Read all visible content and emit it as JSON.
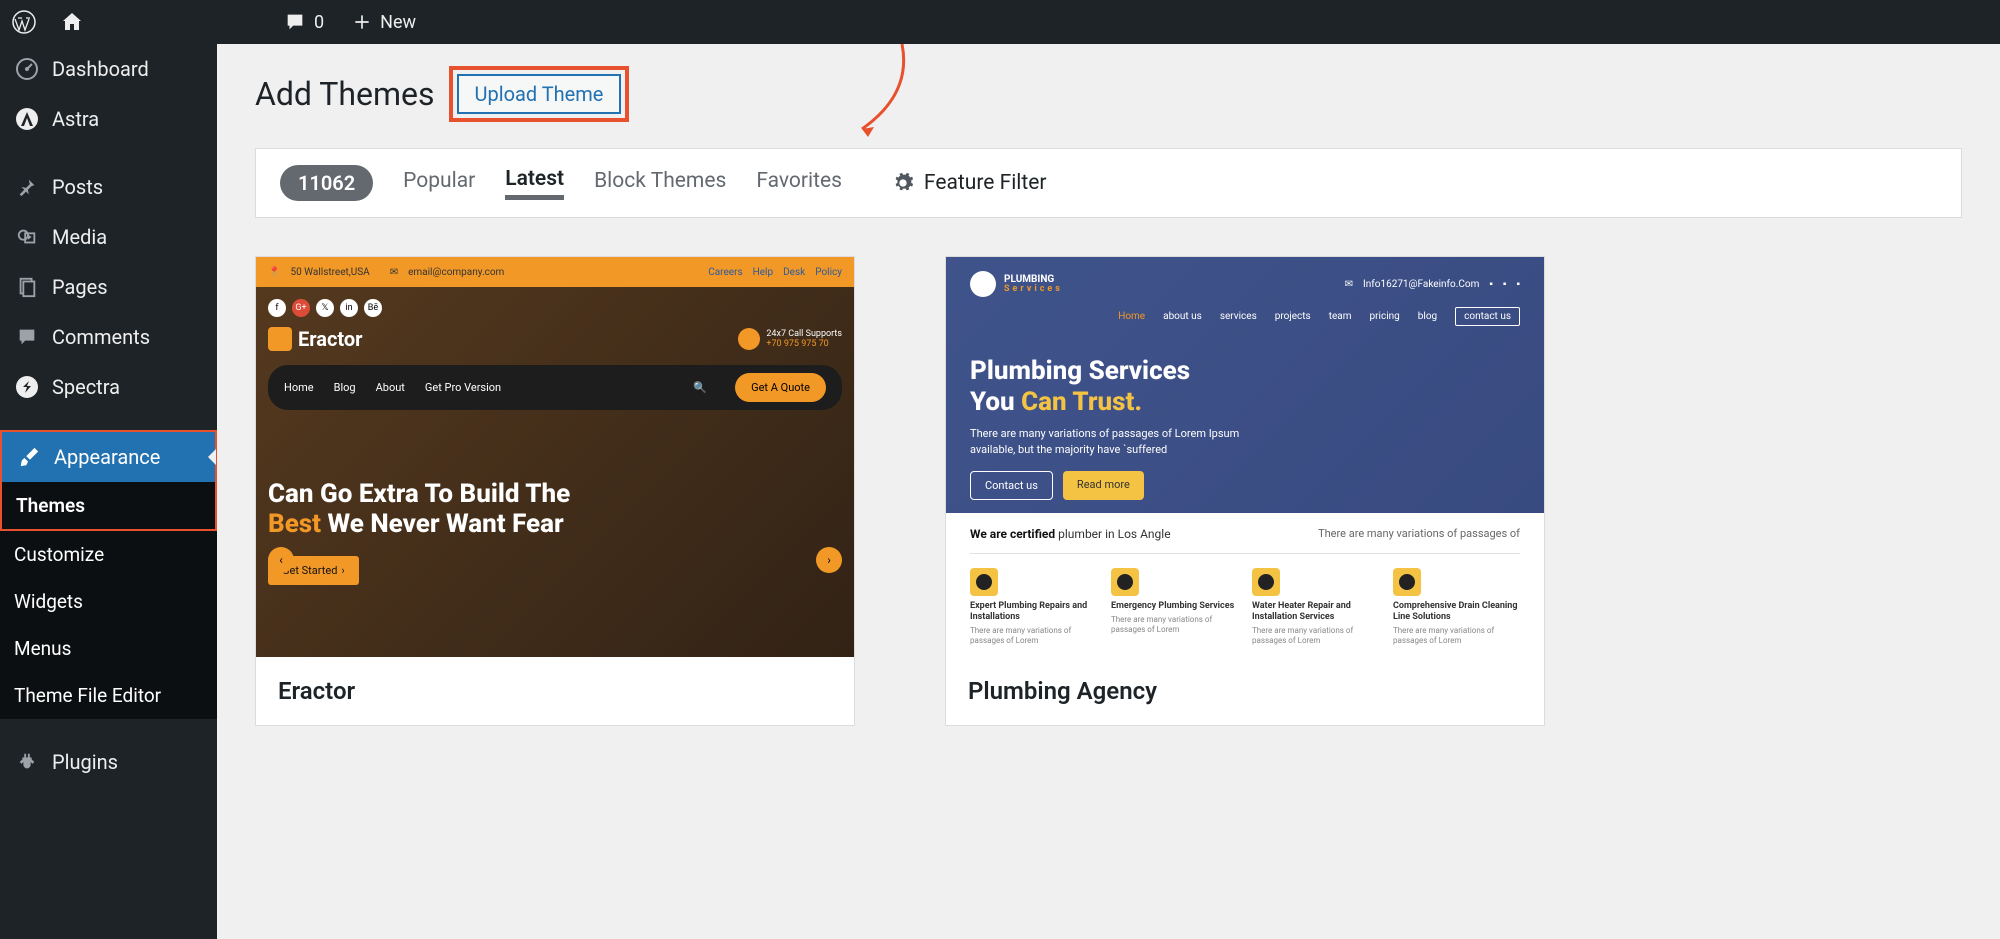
{
  "topbar": {
    "comments_count": "0",
    "new_label": "New"
  },
  "sidebar": {
    "dashboard": "Dashboard",
    "astra": "Astra",
    "posts": "Posts",
    "media": "Media",
    "pages": "Pages",
    "comments": "Comments",
    "spectra": "Spectra",
    "appearance": "Appearance",
    "themes": "Themes",
    "customize": "Customize",
    "widgets": "Widgets",
    "menus": "Menus",
    "theme_file_editor": "Theme File Editor",
    "plugins": "Plugins"
  },
  "page": {
    "title": "Add Themes",
    "upload_button": "Upload Theme"
  },
  "filter": {
    "count": "11062",
    "popular": "Popular",
    "latest": "Latest",
    "block_themes": "Block Themes",
    "favorites": "Favorites",
    "feature_filter": "Feature Filter"
  },
  "themes": [
    {
      "name": "Eractor"
    },
    {
      "name": "Plumbing Agency"
    }
  ],
  "eractor": {
    "address": "50 Wallstreet,USA",
    "email": "email@company.com",
    "links": {
      "careers": "Careers",
      "help": "Help",
      "desk": "Desk",
      "policy": "Policy"
    },
    "logo": "Eractor",
    "call_label": "24x7 Call Supports",
    "call_number": "+70 975 975 70",
    "nav": {
      "home": "Home",
      "blog": "Blog",
      "about": "About",
      "pro": "Get Pro Version"
    },
    "quote": "Get A Quote",
    "headline1": "Can Go Extra To Build The",
    "headline2a": "Best",
    "headline2b": " We Never Want Fear",
    "cta": "Get Started"
  },
  "plumbing": {
    "logo_main": "PLUMBING",
    "logo_sub": "Services",
    "info_email": "Info16271@Fakeinfo.Com",
    "nav": {
      "home": "Home",
      "about": "about us",
      "services": "services",
      "projects": "projects",
      "team": "team",
      "pricing": "pricing",
      "blog": "blog",
      "contact": "contact us"
    },
    "headline1": "Plumbing Services",
    "headline2a": "You ",
    "headline2b": "Can Trust.",
    "desc": "There are many variations of passages of Lorem Ipsum available, but the majority have `suffered",
    "btn_contact": "Contact us",
    "btn_read": "Read more",
    "cert_bold": "We are certified",
    "cert_rest": " plumber in Los Angle",
    "cert_right": "There are many variations of passages of",
    "services": [
      {
        "title": "Expert Plumbing Repairs and Installations",
        "desc": "There are many variations of passages of Lorem"
      },
      {
        "title": "Emergency Plumbing Services",
        "desc": "There are many variations of passages of Lorem"
      },
      {
        "title": "Water Heater Repair and Installation Services",
        "desc": "There are many variations of passages of Lorem"
      },
      {
        "title": "Comprehensive Drain Cleaning Line Solutions",
        "desc": "There are many variations of passages of Lorem"
      }
    ]
  }
}
